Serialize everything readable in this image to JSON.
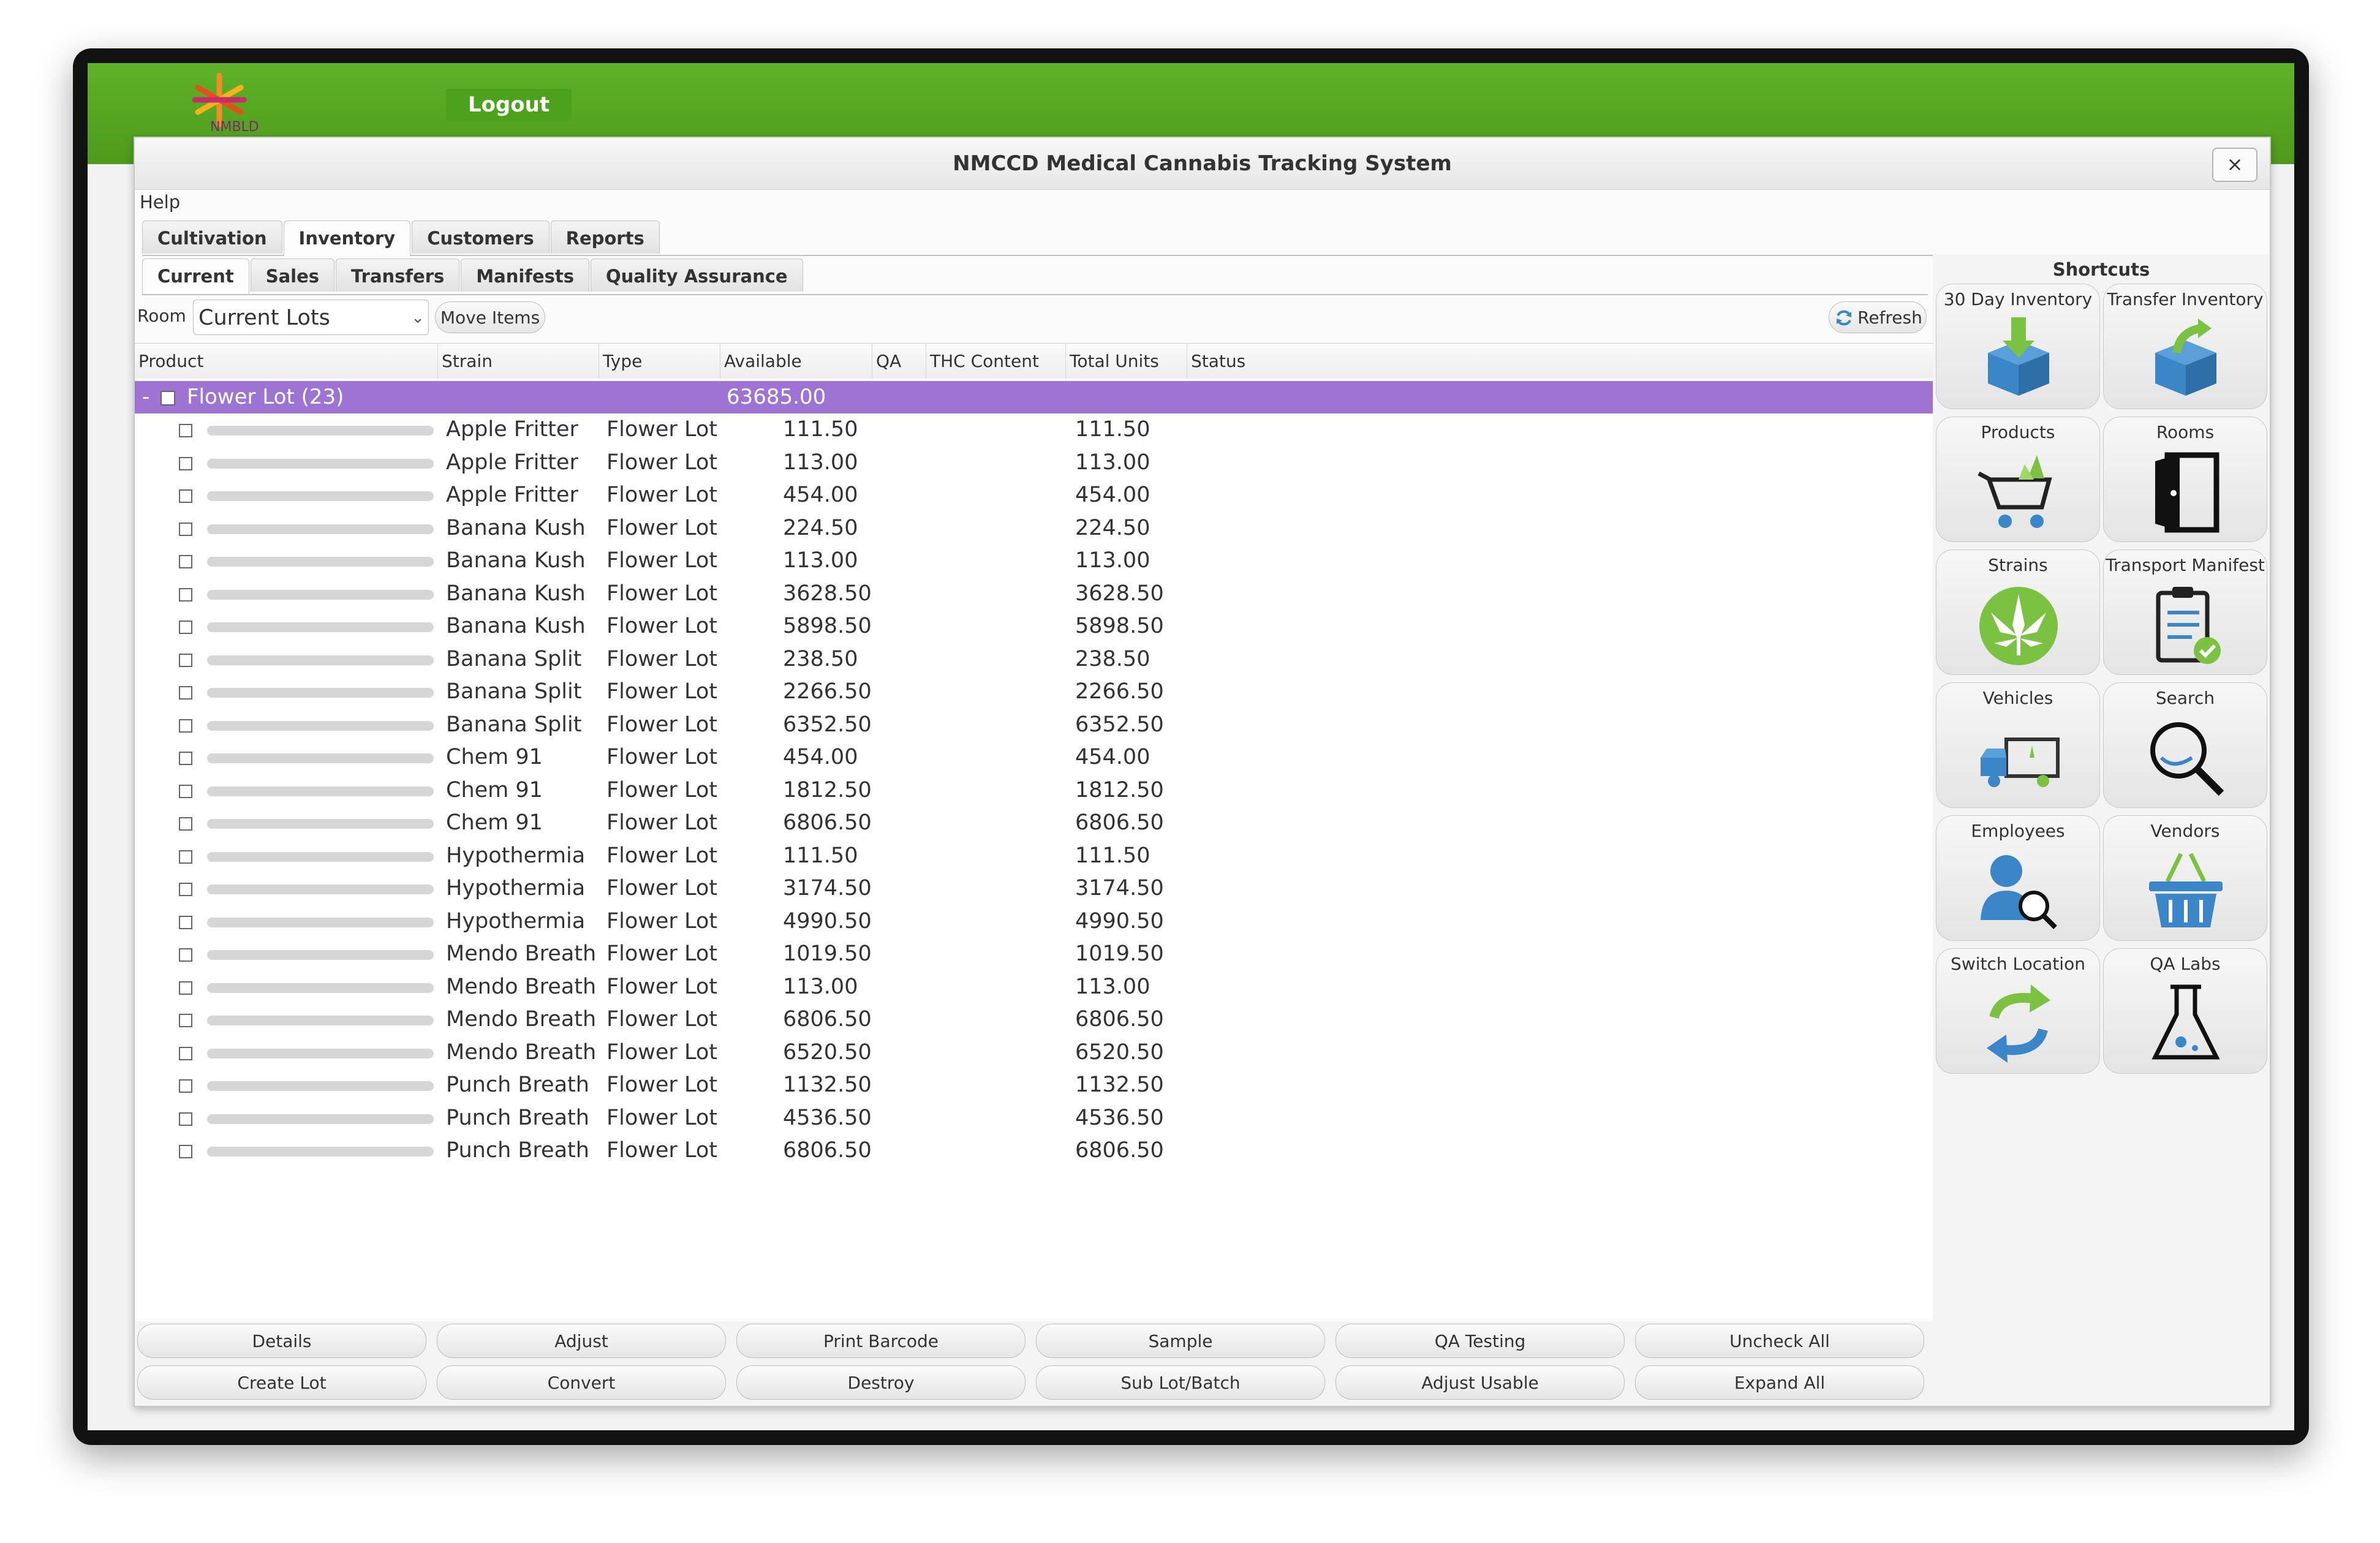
{
  "header": {
    "logout_label": "Logout",
    "logo_text": "NMBLD"
  },
  "window": {
    "title": "NMCCD Medical Cannabis Tracking System",
    "close_glyph": "×"
  },
  "menu": {
    "help_label": "Help"
  },
  "main_tabs": [
    {
      "label": "Cultivation",
      "active": false
    },
    {
      "label": "Inventory",
      "active": true
    },
    {
      "label": "Customers",
      "active": false
    },
    {
      "label": "Reports",
      "active": false
    }
  ],
  "sub_tabs": [
    {
      "label": "Current",
      "active": true
    },
    {
      "label": "Sales",
      "active": false
    },
    {
      "label": "Transfers",
      "active": false
    },
    {
      "label": "Manifests",
      "active": false
    },
    {
      "label": "Quality Assurance",
      "active": false
    }
  ],
  "toolbar": {
    "room_label": "Room",
    "room_value": "Current Lots",
    "move_items_label": "Move Items",
    "refresh_label": "Refresh"
  },
  "columns": [
    "Product",
    "Strain",
    "Type",
    "Available",
    "QA",
    "THC Content",
    "Total Units",
    "Status"
  ],
  "group": {
    "expander": "-",
    "label": "Flower Lot (23)",
    "available": "63685.00"
  },
  "rows": [
    {
      "strain": "Apple Fritter",
      "type": "Flower Lot",
      "available": "111.50",
      "total": "111.50"
    },
    {
      "strain": "Apple Fritter",
      "type": "Flower Lot",
      "available": "113.00",
      "total": "113.00"
    },
    {
      "strain": "Apple Fritter",
      "type": "Flower Lot",
      "available": "454.00",
      "total": "454.00"
    },
    {
      "strain": "Banana Kush",
      "type": "Flower Lot",
      "available": "224.50",
      "total": "224.50"
    },
    {
      "strain": "Banana Kush",
      "type": "Flower Lot",
      "available": "113.00",
      "total": "113.00"
    },
    {
      "strain": "Banana Kush",
      "type": "Flower Lot",
      "available": "3628.50",
      "total": "3628.50"
    },
    {
      "strain": "Banana Kush",
      "type": "Flower Lot",
      "available": "5898.50",
      "total": "5898.50"
    },
    {
      "strain": "Banana Split",
      "type": "Flower Lot",
      "available": "238.50",
      "total": "238.50"
    },
    {
      "strain": "Banana Split",
      "type": "Flower Lot",
      "available": "2266.50",
      "total": "2266.50"
    },
    {
      "strain": "Banana Split",
      "type": "Flower Lot",
      "available": "6352.50",
      "total": "6352.50"
    },
    {
      "strain": "Chem 91",
      "type": "Flower Lot",
      "available": "454.00",
      "total": "454.00"
    },
    {
      "strain": "Chem 91",
      "type": "Flower Lot",
      "available": "1812.50",
      "total": "1812.50"
    },
    {
      "strain": "Chem 91",
      "type": "Flower Lot",
      "available": "6806.50",
      "total": "6806.50"
    },
    {
      "strain": "Hypothermia",
      "type": "Flower Lot",
      "available": "111.50",
      "total": "111.50"
    },
    {
      "strain": "Hypothermia",
      "type": "Flower Lot",
      "available": "3174.50",
      "total": "3174.50"
    },
    {
      "strain": "Hypothermia",
      "type": "Flower Lot",
      "available": "4990.50",
      "total": "4990.50"
    },
    {
      "strain": "Mendo Breath",
      "type": "Flower Lot",
      "available": "1019.50",
      "total": "1019.50"
    },
    {
      "strain": "Mendo Breath",
      "type": "Flower Lot",
      "available": "113.00",
      "total": "113.00"
    },
    {
      "strain": "Mendo Breath",
      "type": "Flower Lot",
      "available": "6806.50",
      "total": "6806.50"
    },
    {
      "strain": "Mendo Breath",
      "type": "Flower Lot",
      "available": "6520.50",
      "total": "6520.50"
    },
    {
      "strain": "Punch Breath",
      "type": "Flower Lot",
      "available": "1132.50",
      "total": "1132.50"
    },
    {
      "strain": "Punch Breath",
      "type": "Flower Lot",
      "available": "4536.50",
      "total": "4536.50"
    },
    {
      "strain": "Punch Breath",
      "type": "Flower Lot",
      "available": "6806.50",
      "total": "6806.50"
    }
  ],
  "bottom_buttons": {
    "row1": [
      "Details",
      "Adjust",
      "Print Barcode",
      "Sample",
      "QA Testing",
      "Uncheck All"
    ],
    "row2": [
      "Create Lot",
      "Convert",
      "Destroy",
      "Sub Lot/Batch",
      "Adjust Usable",
      "Expand All"
    ]
  },
  "shortcuts": {
    "title": "Shortcuts",
    "tiles": [
      {
        "label": "30 Day Inventory",
        "icon": "box-download-icon"
      },
      {
        "label": "Transfer Inventory",
        "icon": "box-transfer-icon"
      },
      {
        "label": "Products",
        "icon": "cart-icon"
      },
      {
        "label": "Rooms",
        "icon": "door-icon"
      },
      {
        "label": "Strains",
        "icon": "leaf-icon"
      },
      {
        "label": "Transport Manifest",
        "icon": "clipboard-icon"
      },
      {
        "label": "Vehicles",
        "icon": "truck-icon"
      },
      {
        "label": "Search",
        "icon": "magnifier-icon"
      },
      {
        "label": "Employees",
        "icon": "employee-search-icon"
      },
      {
        "label": "Vendors",
        "icon": "basket-icon"
      },
      {
        "label": "Switch Location",
        "icon": "switch-arrows-icon"
      },
      {
        "label": "QA Labs",
        "icon": "flask-icon"
      }
    ]
  },
  "colors": {
    "header_green": "#5fb228",
    "group_row": "#9d73d3",
    "icon_blue": "#3a86c8",
    "icon_green": "#7cc242"
  }
}
